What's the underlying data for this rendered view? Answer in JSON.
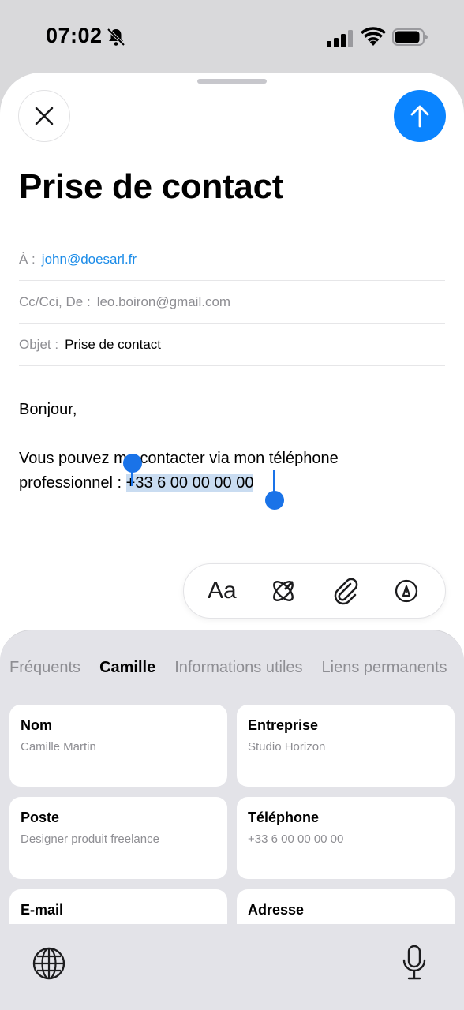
{
  "status": {
    "time": "07:02"
  },
  "compose": {
    "title": "Prise de contact",
    "to_label": "À :",
    "to_value": "john@doesarl.fr",
    "cc_label": "Cc/Cci, De :",
    "cc_value": "leo.boiron@gmail.com",
    "subject_label": "Objet :",
    "subject_value": "Prise de contact",
    "body_line1": "Bonjour,",
    "body_line2": "Vous pouvez me contacter via mon téléphone",
    "body_line3_prefix": "professionnel : ",
    "body_line3_selected": "+33 6 00 00 00 00"
  },
  "toolbar": {
    "aa_label": "Aa"
  },
  "keyboard": {
    "tabs": [
      {
        "label": "Fréquents"
      },
      {
        "label": "Camille"
      },
      {
        "label": "Informations utiles"
      },
      {
        "label": "Liens permanents"
      }
    ],
    "cards": [
      {
        "label": "Nom",
        "value": "Camille Martin"
      },
      {
        "label": "Entreprise",
        "value": "Studio Horizon"
      },
      {
        "label": "Poste",
        "value": "Designer produit freelance"
      },
      {
        "label": "Téléphone",
        "value": "+33 6 00 00 00 00"
      },
      {
        "label": "E-mail",
        "value": ""
      },
      {
        "label": "Adresse",
        "value": ""
      }
    ]
  },
  "colors": {
    "accent": "#0a84ff",
    "selection": "#c9dcf1",
    "link": "#1a8be8"
  }
}
